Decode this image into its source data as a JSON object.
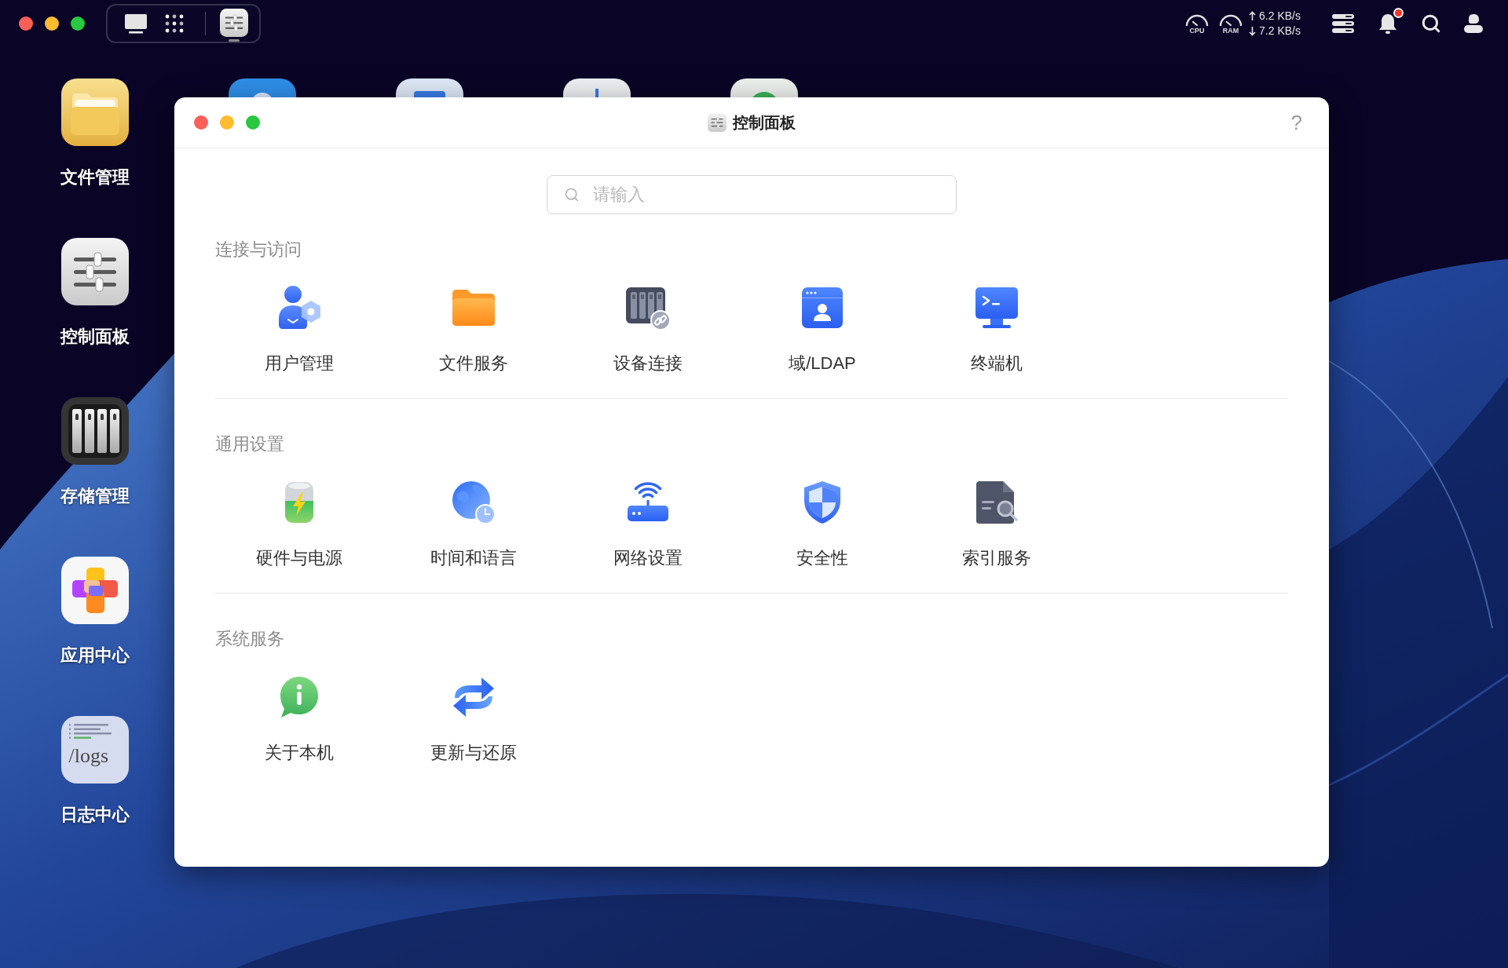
{
  "top_bar": {
    "dock": {
      "buttons": [
        {
          "kind": "desktop"
        },
        {
          "kind": "launcher"
        }
      ],
      "apps": [
        {
          "kind": "control_panel",
          "running": true
        }
      ]
    },
    "status": {
      "gauges": [
        {
          "label": "CPU"
        },
        {
          "label": "RAM"
        }
      ],
      "upload": "6.2 KB/s",
      "download": "7.2 KB/s",
      "notifications": {
        "unread": true
      }
    }
  },
  "desktop": {
    "icons": [
      {
        "kind": "files",
        "label": "文件管理"
      },
      {
        "kind": "control_panel",
        "label": "控制面板"
      },
      {
        "kind": "storage",
        "label": "存储管理"
      },
      {
        "kind": "app_center",
        "label": "应用中心"
      },
      {
        "kind": "logs",
        "label": "日志中心",
        "icon_text": "/logs"
      }
    ],
    "covered_icons": [
      {
        "kind": "blue_badge"
      },
      {
        "kind": "blue_window"
      },
      {
        "kind": "light_bar"
      },
      {
        "kind": "green_circle"
      }
    ]
  },
  "window": {
    "title": "控制面板",
    "help": "?",
    "search": {
      "placeholder": "请输入"
    },
    "sections": [
      {
        "title": "连接与访问",
        "items": [
          {
            "kind": "users",
            "label": "用户管理"
          },
          {
            "kind": "file_service",
            "label": "文件服务"
          },
          {
            "kind": "device_connect",
            "label": "设备连接"
          },
          {
            "kind": "domain_ldap",
            "label": "域/LDAP"
          },
          {
            "kind": "terminal",
            "label": "终端机"
          }
        ]
      },
      {
        "title": "通用设置",
        "items": [
          {
            "kind": "hardware_power",
            "label": "硬件与电源"
          },
          {
            "kind": "time_language",
            "label": "时间和语言"
          },
          {
            "kind": "network",
            "label": "网络设置"
          },
          {
            "kind": "security",
            "label": "安全性"
          },
          {
            "kind": "index_service",
            "label": "索引服务"
          }
        ]
      },
      {
        "title": "系统服务",
        "items": [
          {
            "kind": "about",
            "label": "关于本机"
          },
          {
            "kind": "update_restore",
            "label": "更新与还原"
          }
        ]
      }
    ]
  }
}
